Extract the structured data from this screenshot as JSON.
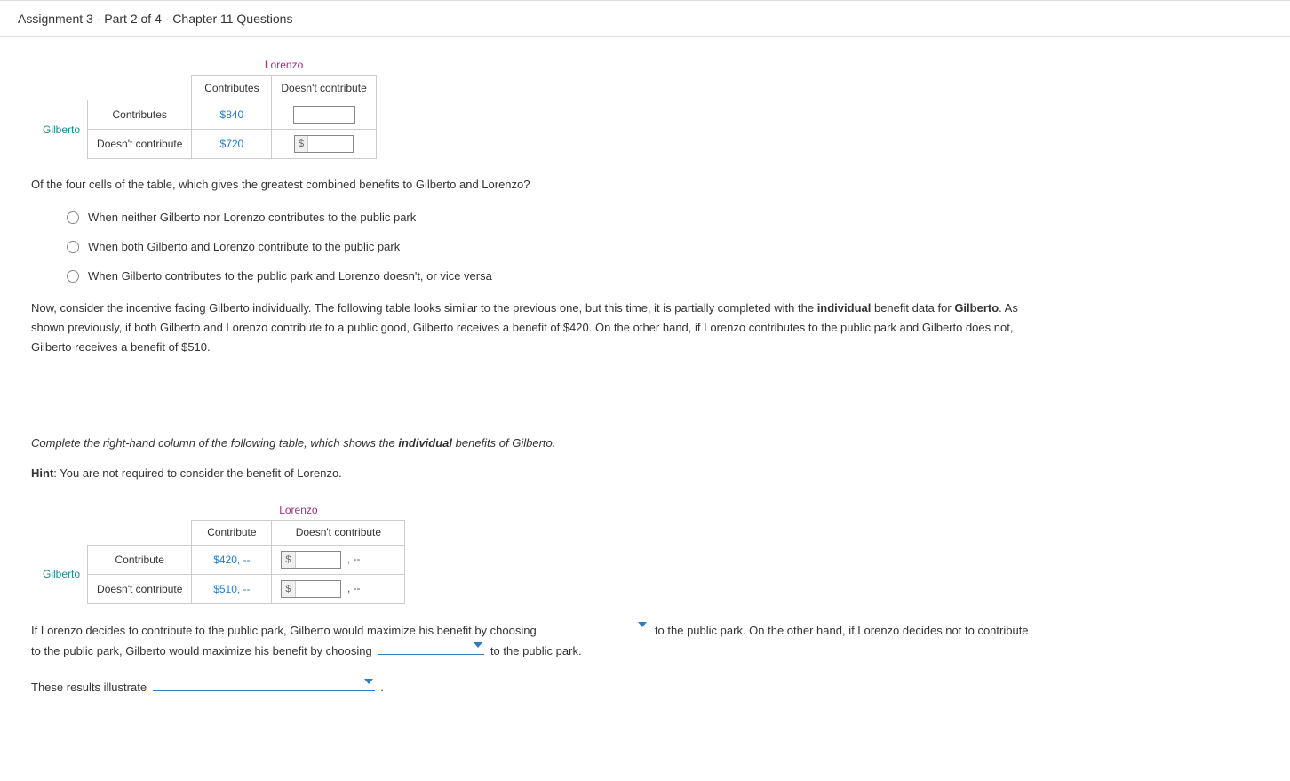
{
  "header": {
    "title": "Assignment 3 - Part 2 of 4 - Chapter 11 Questions"
  },
  "table1": {
    "col_player": "Lorenzo",
    "row_player": "Gilberto",
    "col_headers": [
      "Contributes",
      "Doesn't contribute"
    ],
    "row_headers": [
      "Contributes",
      "Doesn't contribute"
    ],
    "cells": {
      "r1c1": "$840",
      "r2c1": "$720"
    },
    "dollar_sym": "$"
  },
  "q1": {
    "prompt": "Of the four cells of the table, which gives the greatest combined benefits to Gilberto and Lorenzo?",
    "options": [
      "When neither Gilberto nor Lorenzo contributes to the public park",
      "When both Gilberto and Lorenzo contribute to the public park",
      "When Gilberto contributes to the public park and Lorenzo doesn't, or vice versa"
    ]
  },
  "para2": {
    "t1": "Now, consider the incentive facing Gilberto individually. The following table looks similar to the previous one, but this time, it is partially completed with the ",
    "b1": "individual",
    "t2": " benefit data for ",
    "b2": "Gilberto",
    "t3": ". As shown previously, if both Gilberto and Lorenzo contribute to a public good, Gilberto receives a benefit of $420. On the other hand, if Lorenzo contributes to the public park and Gilberto does not, Gilberto receives a benefit of $510."
  },
  "instr": {
    "t1": "Complete the right-hand column of the following table, which shows the ",
    "b1": "individual",
    "t2": " benefits of Gilberto."
  },
  "hint": {
    "label": "Hint",
    "text": ": You are not required to consider the benefit of Lorenzo."
  },
  "table2": {
    "col_player": "Lorenzo",
    "row_player": "Gilberto",
    "col_headers": [
      "Contribute",
      "Doesn't contribute"
    ],
    "row_headers": [
      "Contribute",
      "Doesn't contribute"
    ],
    "cells": {
      "r1c1": "$420, --",
      "r2c1": "$510, --"
    },
    "dollar_sym": "$",
    "suffix": ", --"
  },
  "fill": {
    "t1": "If Lorenzo decides to contribute to the public park, Gilberto would maximize his benefit by choosing ",
    "t2": " to the public park. On the other hand, if Lorenzo decides not to contribute to the public park, Gilberto would maximize his benefit by choosing ",
    "t3": " to the public park.",
    "t4": "These results illustrate ",
    "t5": " ."
  }
}
